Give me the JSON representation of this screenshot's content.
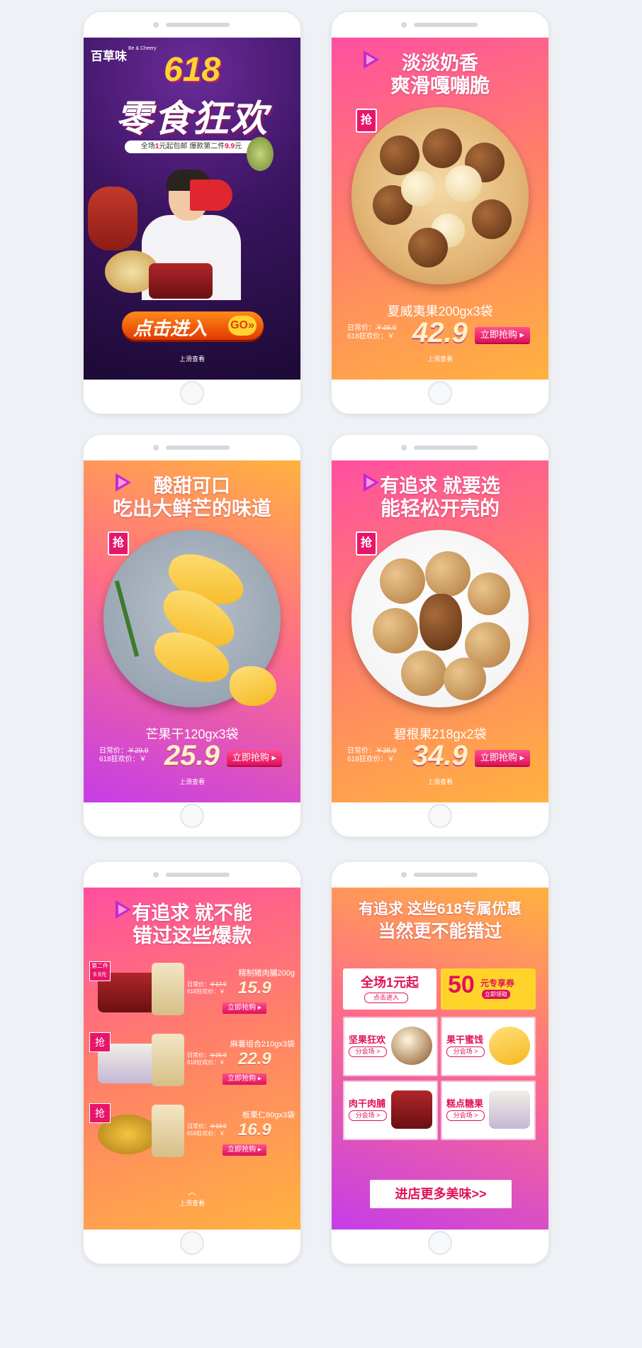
{
  "phone1": {
    "logo": "百草味",
    "logo_en": "Be & Cheery",
    "title_618": "618",
    "title_main": "零食狂欢",
    "sub_prefix": "全场",
    "sub_one": "1",
    "sub_mid": "元起包邮 爆款第二件",
    "sub_price": "9.9",
    "sub_suffix": "元",
    "enter_label": "点击进入",
    "go_label": "GO»",
    "slide_hint": "上滑查看"
  },
  "phone2": {
    "line1": "淡淡奶香",
    "line2": "爽滑嘎嘣脆",
    "qiang": "抢",
    "product": "夏威夷果200gx3袋",
    "daily_label": "日常价：",
    "daily_price": "￥46.9",
    "sale_label": "618狂欢价：￥",
    "price": "42.9",
    "buy": "立即抢购 ▸",
    "slide_hint": "上滑查看"
  },
  "phone3": {
    "line1": "酸甜可口",
    "line2": "吃出大鲜芒的味道",
    "qiang": "抢",
    "product": "芒果干120gx3袋",
    "daily_label": "日常价：",
    "daily_price": "￥29.9",
    "sale_label": "618狂欢价：￥",
    "price": "25.9",
    "buy": "立即抢购 ▸",
    "slide_hint": "上滑查看"
  },
  "phone4": {
    "line1": "有追求 就要选",
    "line2": "能轻松开壳的",
    "qiang": "抢",
    "product": "碧根果218gx2袋",
    "daily_label": "日常价：",
    "daily_price": "￥38.9",
    "sale_label": "618狂欢价：￥",
    "price": "34.9",
    "buy": "立即抢购 ▸",
    "slide_hint": "上滑查看"
  },
  "phone5": {
    "line1": "有追求 就不能",
    "line2": "错过这些爆款",
    "items": [
      {
        "tag": "第二件\n9.9元",
        "name": "精制猪肉脯200g",
        "daily_label": "日常价：",
        "daily_price": "￥17.9",
        "sale_label": "618狂欢价：￥",
        "price": "15.9",
        "buy": "立即抢购 ▸"
      },
      {
        "tag": "抢",
        "name": "麻薯组合210gx3袋",
        "daily_label": "日常价：",
        "daily_price": "￥25.9",
        "sale_label": "618狂欢价：￥",
        "price": "22.9",
        "buy": "立即抢购 ▸"
      },
      {
        "tag": "抢",
        "name": "板栗仁80gx3袋",
        "daily_label": "日常价：",
        "daily_price": "￥19.9",
        "sale_label": "618狂欢价：￥",
        "price": "16.9",
        "buy": "立即抢购 ▸"
      }
    ],
    "slide_hint": "上滑查看"
  },
  "phone6": {
    "line1": "有追求 这些618专属优惠",
    "line2": "当然更不能错过",
    "coupon1_title": "全场1元起",
    "coupon1_btn": "点击进入",
    "coupon2_num": "50",
    "coupon2_unit": "元专享券",
    "coupon2_btn": "立即领取",
    "cats": [
      {
        "title": "坚果狂欢",
        "btn": "分会场 >"
      },
      {
        "title": "果干蜜饯",
        "btn": "分会场 >"
      },
      {
        "title": "肉干肉脯",
        "btn": "分会场 >"
      },
      {
        "title": "糕点糖果",
        "btn": "分会场 >"
      }
    ],
    "shop_more": "进店更多美味>>"
  },
  "colors": {
    "accent": "#e0105a",
    "gradient_pink": "#ff4fa0",
    "gradient_orange": "#ffb23f",
    "gradient_purple": "#c53de8",
    "page_bg": "#eef1f5"
  }
}
